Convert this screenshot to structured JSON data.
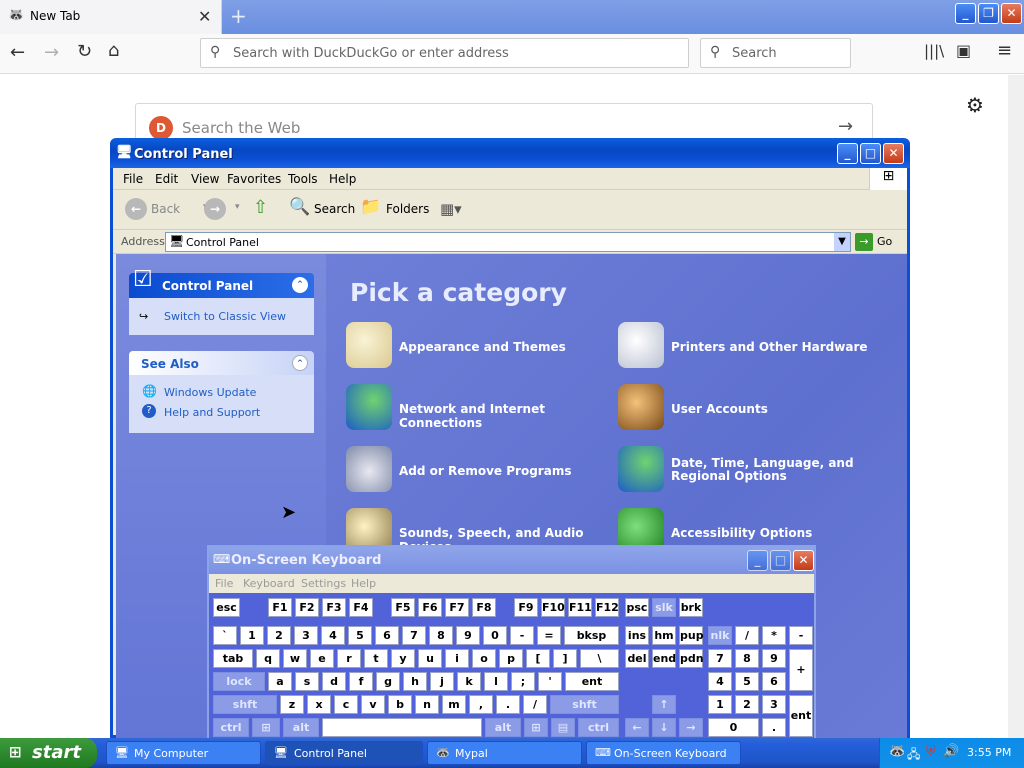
{
  "browser": {
    "tab_title": "New Tab",
    "url_placeholder": "Search with DuckDuckGo or enter address",
    "search_placeholder": "Search",
    "content_search_placeholder": "Search the Web"
  },
  "control_panel": {
    "title": "Control Panel",
    "menu": [
      "File",
      "Edit",
      "View",
      "Favorites",
      "Tools",
      "Help"
    ],
    "toolbar": {
      "back": "Back",
      "search": "Search",
      "folders": "Folders"
    },
    "address_label": "Address",
    "address_value": "Control Panel",
    "go_label": "Go",
    "left_panel": {
      "title": "Control Panel",
      "switch_link": "Switch to Classic View",
      "see_also_title": "See Also",
      "see_also_links": [
        "Windows Update",
        "Help and Support"
      ]
    },
    "heading": "Pick a category",
    "categories": [
      "Appearance and Themes",
      "Printers and Other Hardware",
      "Network and Internet Connections",
      "User Accounts",
      "Add or Remove Programs",
      "Date, Time, Language, and Regional Options",
      "Sounds, Speech, and Audio Devices",
      "Accessibility Options"
    ]
  },
  "osk": {
    "title": "On-Screen Keyboard",
    "menu": [
      "File",
      "Keyboard",
      "Settings",
      "Help"
    ]
  },
  "taskbar": {
    "start_label": "start",
    "items": [
      "My Computer",
      "Control Panel",
      "Mypal",
      "On-Screen Keyboard"
    ],
    "clock": "3:55 PM"
  }
}
